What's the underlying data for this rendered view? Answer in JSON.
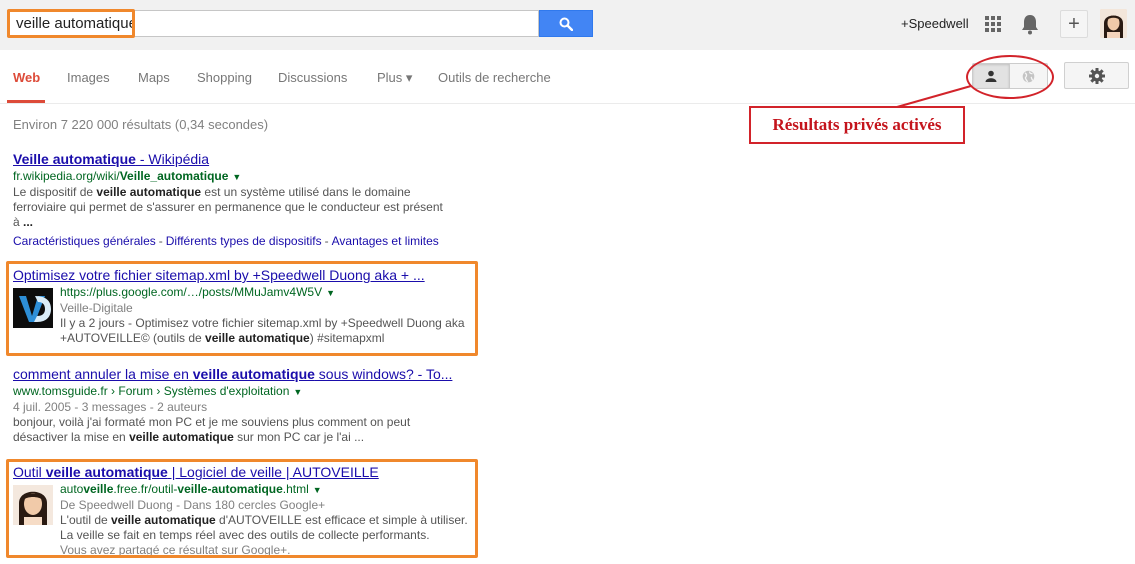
{
  "search": {
    "query": "veille automatique"
  },
  "header": {
    "user_link": "+Speedwell",
    "plus_label": "+"
  },
  "nav": {
    "tabs": [
      {
        "label": "Web",
        "active": true
      },
      {
        "label": "Images"
      },
      {
        "label": "Maps"
      },
      {
        "label": "Shopping"
      },
      {
        "label": "Discussions"
      },
      {
        "label": "Plus ▾"
      },
      {
        "label": "Outils de recherche"
      }
    ]
  },
  "annotation": {
    "text": "Résultats privés activés",
    "color": "#d2232a"
  },
  "stats": "Environ 7 220 000 résultats (0,34 secondes)",
  "results": [
    {
      "title_pre": "",
      "title_bold": "Veille automatique",
      "title_post": " - Wikipédia",
      "url_pre": "fr.wikipedia.org/wiki/",
      "url_bold": "Veille_automatique",
      "snippet_line1_pre": "Le dispositif de ",
      "snippet_line1_bold": "veille automatique",
      "snippet_line1_post": " est un système utilisé dans le domaine",
      "snippet_line2": "ferroviaire qui permet de s'assurer en permanence que le conducteur est présent",
      "snippet_line3": "à ...",
      "sitelinks": [
        "Caractéristiques générales",
        "Différents types de dispositifs",
        "Avantages et limites"
      ]
    },
    {
      "title": "Optimisez votre fichier sitemap.xml by +Speedwell Duong aka + ...",
      "url": "https://plus.google.com/…/posts/MMuJamv4W5V",
      "meta": "Veille-Digitale",
      "snippet_line1": "Il y a 2 jours - Optimisez votre fichier sitemap.xml by +Speedwell Duong aka",
      "snippet_line2_pre": "+AUTOVEILLE© (outils de ",
      "snippet_line2_bold": "veille automatique",
      "snippet_line2_post": ") #sitemapxml"
    },
    {
      "title_pre": "comment annuler la mise en ",
      "title_bold": "veille automatique",
      "title_post": " sous windows? - To...",
      "url": "www.tomsguide.fr › Forum › Systèmes d'exploitation",
      "meta": "4 juil. 2005 - 3 messages - 2 auteurs",
      "snippet_line1": "bonjour, voilà j'ai formaté mon PC et je me souviens plus comment on peut",
      "snippet_line2_pre": "désactiver la mise en ",
      "snippet_line2_bold": "veille automatique",
      "snippet_line2_post": " sur mon PC car je l'ai ..."
    },
    {
      "title_pre": "Outil ",
      "title_bold": "veille automatique",
      "title_post": " | Logiciel de veille | AUTOVEILLE",
      "url_a": "auto",
      "url_b": "veille",
      "url_c": ".free.fr/outil-",
      "url_d": "veille-automatique",
      "url_e": ".html",
      "meta": "De Speedwell Duong - Dans 180 cercles Google+",
      "snippet_line1_pre": "L'outil de ",
      "snippet_line1_bold": "veille automatique",
      "snippet_line1_post": " d'AUTOVEILLE est efficace et simple à utiliser.",
      "snippet_line2": "La veille se fait en temps réel avec des outils de collecte performants.",
      "shared": "Vous avez partagé ce résultat sur Google+."
    }
  ],
  "colors": {
    "highlight_box": "#f0882c",
    "link": "#1a0dab",
    "url": "#006621",
    "active_tab": "#dd4b39",
    "search_button": "#4285f4"
  },
  "icons": [
    "search-icon",
    "apps-grid-icon",
    "bell-icon",
    "person-icon",
    "globe-icon",
    "gear-icon"
  ]
}
